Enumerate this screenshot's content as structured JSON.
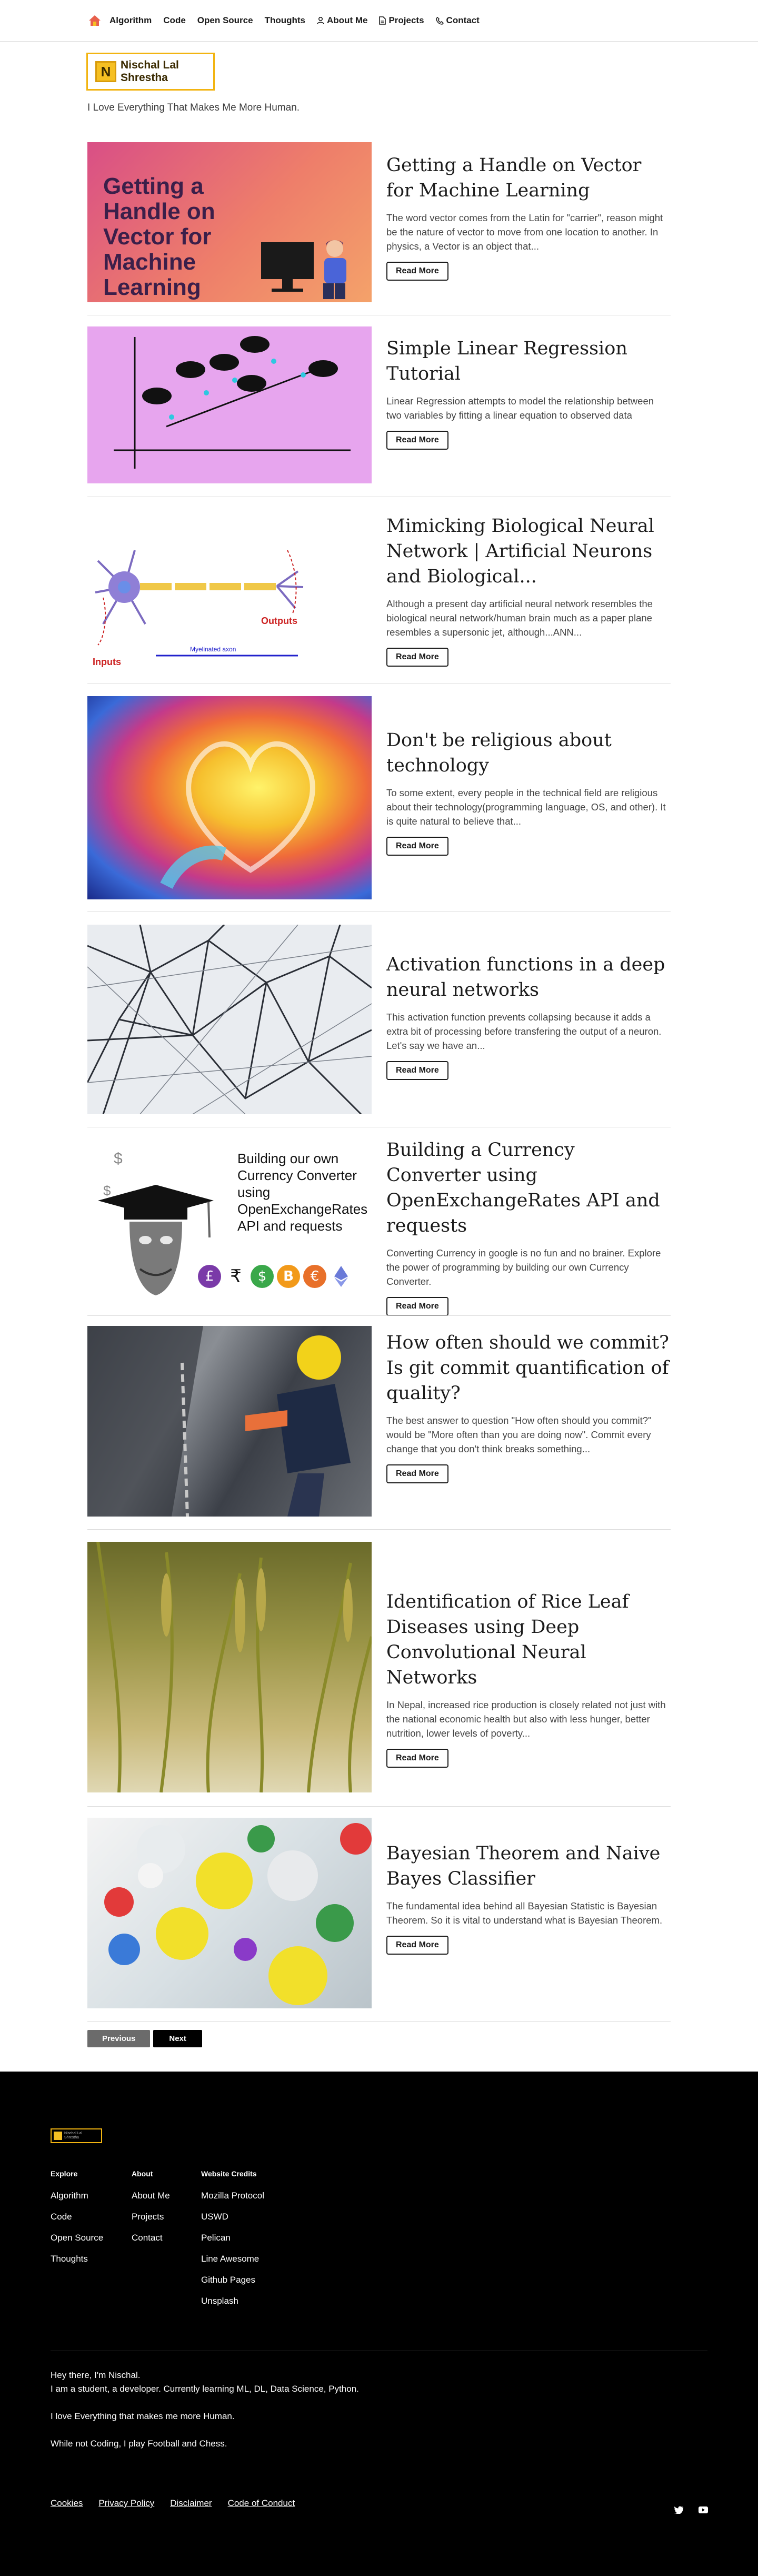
{
  "nav": {
    "items": [
      {
        "label": "Algorithm"
      },
      {
        "label": "Code"
      },
      {
        "label": "Open Source"
      },
      {
        "label": "Thoughts"
      },
      {
        "label": "About Me"
      },
      {
        "label": "Projects"
      },
      {
        "label": "Contact"
      }
    ]
  },
  "site": {
    "logo_mark": "N",
    "logo_line1": "Nischal Lal",
    "logo_line2": "Shrestha",
    "tagline": "I Love Everything That Makes Me More Human."
  },
  "posts": [
    {
      "title": "Getting a Handle on Vector for Machine Learning",
      "excerpt": "The word vector comes from the Latin for \"carrier\", reason might be the nature of vector to move from one location to another. In physics, a Vector is an object that...",
      "button": "Read More",
      "image_text": "Getting a Handle on Vector for Machine Learning"
    },
    {
      "title": "Simple Linear Regression Tutorial",
      "excerpt": "Linear Regression attempts to model the relationship between two variables by fitting a linear equation to observed data",
      "button": "Read More"
    },
    {
      "title": "Mimicking Biological Neural Network | Artificial Neurons and Biological...",
      "excerpt": "Although a present day artificial neural network resembles the biological neural network/human brain much as a paper plane resembles a supersonic jet, although...ANN...",
      "button": "Read More",
      "image_labels": {
        "inputs": "Inputs",
        "outputs": "Outputs",
        "axon": "Myelinated axon"
      }
    },
    {
      "title": "Don't be religious about technology",
      "excerpt": "To some extent, every people in the technical field are religious about their technology(programming language, OS, and other). It is quite natural to believe that...",
      "button": "Read More"
    },
    {
      "title": "Activation functions in a deep neural networks",
      "excerpt": "This activation function prevents collapsing because it adds a extra bit of processing before transfering the output of a neuron. Let's say we have an...",
      "button": "Read More"
    },
    {
      "title": "Building a Currency Converter using OpenExchangeRates API and requests",
      "excerpt": "Converting Currency in google is no fun and no brainer. Explore the power of programming by building our own Currency Converter.",
      "button": "Read More",
      "image_text": "Building our own Currency Converter using OpenExchangeRates API and requests"
    },
    {
      "title": "How often should we commit? Is git commit quantification of quality?",
      "excerpt": "The best answer to question \"How often should you commit?\" would be \"More often than you are doing now\". Commit every change that you don't think breaks something...",
      "button": "Read More"
    },
    {
      "title": "Identification of Rice Leaf Diseases using Deep Convolutional Neural Networks",
      "excerpt": "In Nepal, increased rice production is closely related not just with the national economic health but also with less hunger, better nutrition, lower levels of poverty...",
      "button": "Read More"
    },
    {
      "title": "Bayesian Theorem and Naive Bayes Classifier",
      "excerpt": "The fundamental idea behind all Bayesian Statistic is Bayesian Theorem. So it is vital to understand what is Bayesian Theorem.",
      "button": "Read More"
    }
  ],
  "pagination": {
    "previous": "Previous",
    "next": "Next"
  },
  "footer": {
    "columns": [
      {
        "heading": "Explore",
        "items": [
          "Algorithm",
          "Code",
          "Open Source",
          "Thoughts"
        ]
      },
      {
        "heading": "About",
        "items": [
          "About Me",
          "Projects",
          "Contact"
        ]
      },
      {
        "heading": "Website Credits",
        "items": [
          "Mozilla Protocol",
          "USWD",
          "Pelican",
          "Line Awesome",
          "Github Pages",
          "Unsplash"
        ]
      }
    ],
    "about": {
      "line1": "Hey there, I'm Nischal.",
      "line2": "I am a student, a developer. Currently learning ML, DL, Data Science, Python.",
      "line3": "I love Everything that makes me more Human.",
      "line4": "While not Coding, I play Football and Chess."
    },
    "links": [
      "Cookies",
      "Privacy Policy",
      "Disclaimer",
      "Code of Conduct"
    ]
  },
  "colors": {
    "accent": "#f2b411",
    "primary": "#000000",
    "secondary": "#6b6b6b"
  },
  "icons": [
    "home-icon",
    "user-icon",
    "file-icon",
    "phone-icon",
    "twitter-icon",
    "youtube-icon"
  ]
}
